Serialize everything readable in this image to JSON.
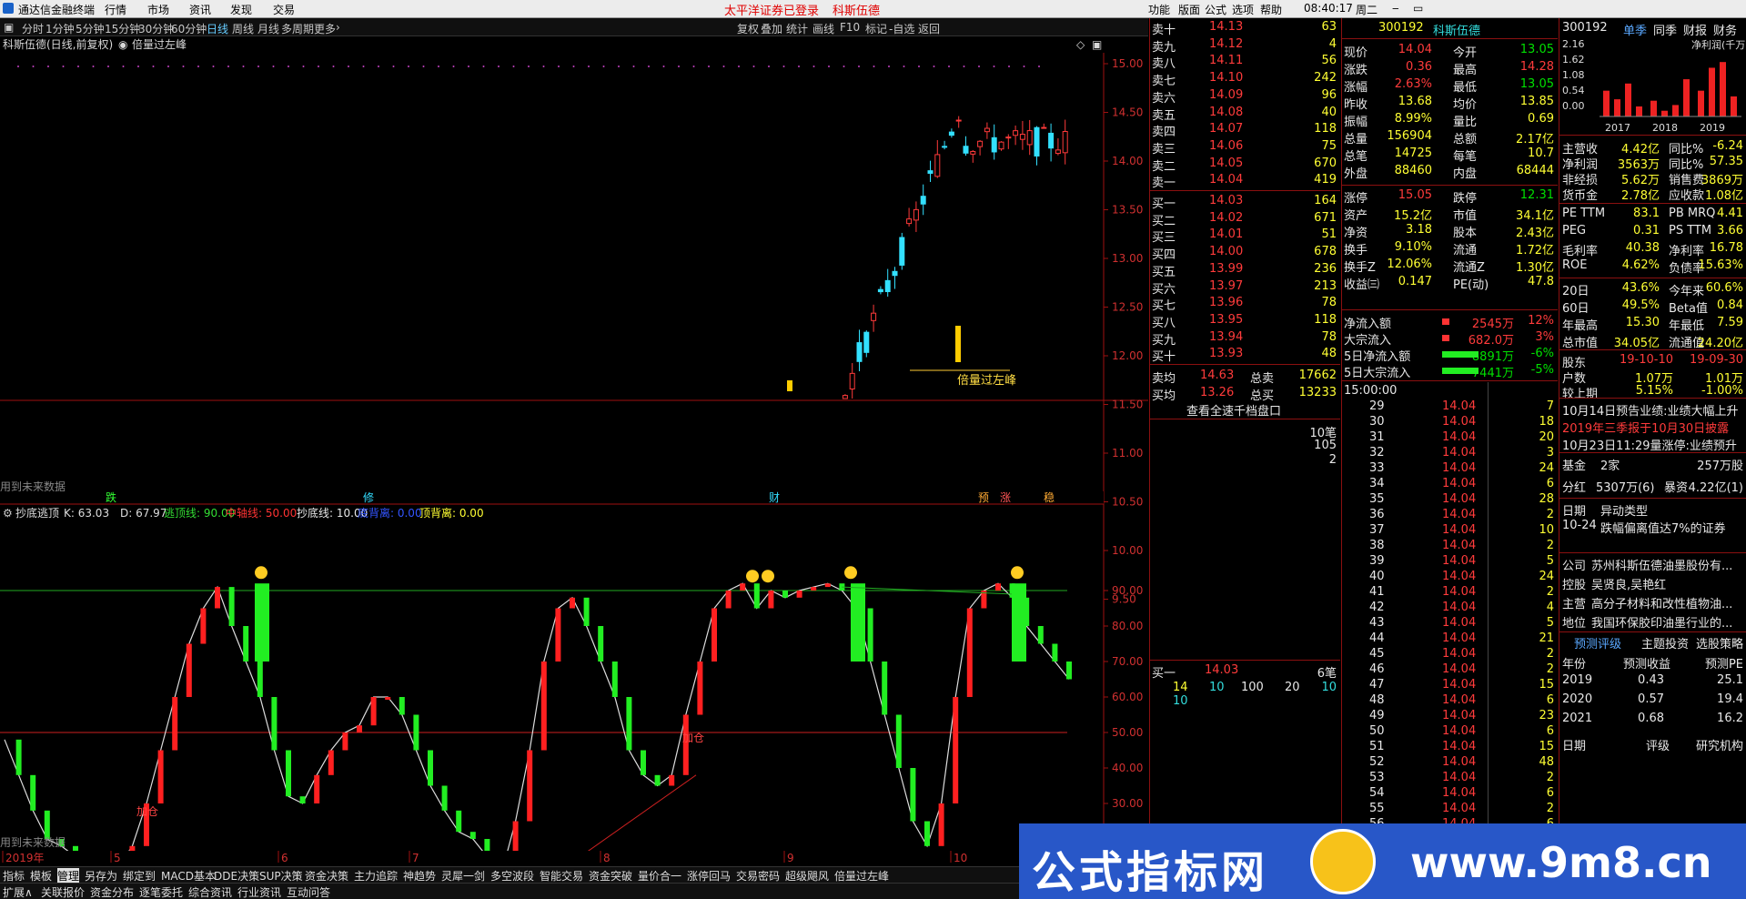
{
  "app": {
    "title": "通达信金融终端",
    "menu": [
      "行情",
      "市场",
      "资讯",
      "发现",
      "交易"
    ],
    "notice": "太平洋证券已登录",
    "stock_name_top": "科斯伍德",
    "right_menu": [
      "功能",
      "版面",
      "公式",
      "选项",
      "帮助"
    ],
    "time": "08:40:17",
    "weekday": "周二"
  },
  "periods": [
    "分时",
    "1分钟",
    "5分钟",
    "15分钟",
    "30分钟",
    "60分钟",
    "日线",
    "周线",
    "月线",
    "多周期",
    "更多"
  ],
  "toolbar": [
    "复权",
    "叠加",
    "统计",
    "画线",
    "F10",
    "标记",
    "-自选",
    "返回"
  ],
  "chart": {
    "header": "科斯伍德(日线,前复权)",
    "indicator_name": "倍量过左峰",
    "price_ticks": [
      "15.00",
      "14.50",
      "14.00",
      "13.50",
      "13.00",
      "12.50",
      "12.00",
      "11.50",
      "11.00",
      "10.50",
      "10.00",
      "9.50"
    ],
    "annotation": "倍量过左峰",
    "future_note": "用到未来数据",
    "markers": [
      "跌",
      "修",
      "财",
      "预",
      "涨",
      "稳"
    ]
  },
  "oscillator": {
    "title": "抄底逃顶",
    "k_label": "K: 63.03",
    "d_label": "D: 67.97",
    "params": [
      {
        "text": "逃顶线: 90.00",
        "color": "#33dd33"
      },
      {
        "text": "中轴线: 50.00",
        "color": "#ff3333"
      },
      {
        "text": "抄底线: 10.00",
        "color": "#e8e8e8"
      },
      {
        "text": "底背离: 0.00",
        "color": "#3355ff"
      },
      {
        "text": "顶背离: 0.00",
        "color": "#ffff33"
      }
    ],
    "ticks": [
      "90.00",
      "80.00",
      "70.00",
      "60.00",
      "50.00",
      "40.00",
      "30.00",
      "20.00",
      "10.00"
    ],
    "labels": [
      "加仓",
      "加仓"
    ],
    "future_note": "用到未来数据"
  },
  "timeline": [
    "2019年",
    "5",
    "6",
    "7",
    "8",
    "9",
    "10"
  ],
  "bottom_tabs_1": [
    "指标",
    "模板",
    "管理",
    "另存为",
    "绑定到",
    "MACD基本",
    "DDE决策",
    "SUP决策",
    "资金决策",
    "主力追踪",
    "神趋势",
    "灵犀一剑",
    "多空波段",
    "智能交易",
    "资金突破",
    "量价合一",
    "涨停回马",
    "交易密码",
    "超级飓风",
    "倍量过左峰"
  ],
  "bottom_tabs_2": [
    "扩展∧",
    "关联报价",
    "资金分布",
    "逐笔委托",
    "综合资讯",
    "行业资讯",
    "互动问答"
  ],
  "orderbook": {
    "asks": [
      [
        "卖十",
        "14.13",
        "63"
      ],
      [
        "卖九",
        "14.12",
        "4"
      ],
      [
        "卖八",
        "14.11",
        "56"
      ],
      [
        "卖七",
        "14.10",
        "242"
      ],
      [
        "卖六",
        "14.09",
        "96"
      ],
      [
        "卖五",
        "14.08",
        "40"
      ],
      [
        "卖四",
        "14.07",
        "118"
      ],
      [
        "卖三",
        "14.06",
        "75"
      ],
      [
        "卖二",
        "14.05",
        "670"
      ],
      [
        "卖一",
        "14.04",
        "419"
      ]
    ],
    "bids": [
      [
        "买一",
        "14.03",
        "164"
      ],
      [
        "买二",
        "14.02",
        "671"
      ],
      [
        "买三",
        "14.01",
        "51"
      ],
      [
        "买四",
        "14.00",
        "678"
      ],
      [
        "买五",
        "13.99",
        "236"
      ],
      [
        "买六",
        "13.97",
        "213"
      ],
      [
        "买七",
        "13.96",
        "78"
      ],
      [
        "买八",
        "13.95",
        "118"
      ],
      [
        "买九",
        "13.94",
        "78"
      ],
      [
        "买十",
        "13.93",
        "48"
      ]
    ],
    "avg": [
      [
        "卖均",
        "14.63",
        "总卖",
        "17662"
      ],
      [
        "买均",
        "13.26",
        "总买",
        "13233"
      ]
    ],
    "more_link": "查看全速千档盘口",
    "tick_count": "10笔",
    "tick_vals": [
      "105",
      "2"
    ],
    "bid1_line": [
      "买一",
      "14.03",
      "6笔"
    ],
    "bid1_queue": [
      "14",
      "10",
      "100",
      "20",
      "10",
      "10"
    ]
  },
  "quote": {
    "code": "300192",
    "name": "科斯伍德",
    "rows": [
      [
        "现价",
        "14.04",
        "今开",
        "13.05"
      ],
      [
        "涨跌",
        "0.36",
        "最高",
        "14.28"
      ],
      [
        "涨幅",
        "2.63%",
        "最低",
        "13.05"
      ],
      [
        "昨收",
        "13.68",
        "均价",
        "13.85"
      ],
      [
        "振幅",
        "8.99%",
        "量比",
        "0.69"
      ],
      [
        "总量",
        "156904",
        "总额",
        "2.17亿"
      ],
      [
        "总笔",
        "14725",
        "每笔",
        "10.7"
      ],
      [
        "外盘",
        "88460",
        "内盘",
        "68444"
      ],
      [
        "涨停",
        "15.05",
        "跌停",
        "12.31"
      ],
      [
        "资产",
        "15.2亿",
        "市值",
        "34.1亿"
      ],
      [
        "净资",
        "3.18",
        "股本",
        "2.43亿"
      ],
      [
        "换手",
        "9.10%",
        "流通",
        "1.72亿"
      ],
      [
        "换手Z",
        "12.06%",
        "流通Z",
        "1.30亿"
      ],
      [
        "收益㈢",
        "0.147",
        "PE(动)",
        "47.8"
      ]
    ],
    "flows": [
      [
        "净流入额",
        "2545万",
        "12%"
      ],
      [
        "大宗流入",
        "682.0万",
        "3%"
      ],
      [
        "5日净流入额",
        "-8891万",
        "-6%"
      ],
      [
        "5日大宗流入",
        "-7441万",
        "-5%"
      ]
    ]
  },
  "ticks": {
    "header": "15:00:00",
    "rows": [
      [
        "29",
        "14.04",
        "7"
      ],
      [
        "30",
        "14.04",
        "18"
      ],
      [
        "31",
        "14.04",
        "20"
      ],
      [
        "32",
        "14.04",
        "3"
      ],
      [
        "33",
        "14.04",
        "24"
      ],
      [
        "34",
        "14.04",
        "6"
      ],
      [
        "35",
        "14.04",
        "28"
      ],
      [
        "36",
        "14.04",
        "2"
      ],
      [
        "37",
        "14.04",
        "10"
      ],
      [
        "38",
        "14.04",
        "2"
      ],
      [
        "39",
        "14.04",
        "5"
      ],
      [
        "40",
        "14.04",
        "24"
      ],
      [
        "41",
        "14.04",
        "2"
      ],
      [
        "42",
        "14.04",
        "4"
      ],
      [
        "43",
        "14.04",
        "5"
      ],
      [
        "44",
        "14.04",
        "21"
      ],
      [
        "45",
        "14.04",
        "2"
      ],
      [
        "46",
        "14.04",
        "2"
      ],
      [
        "47",
        "14.04",
        "15"
      ],
      [
        "48",
        "14.04",
        "6"
      ],
      [
        "49",
        "14.04",
        "23"
      ],
      [
        "50",
        "14.04",
        "6"
      ],
      [
        "51",
        "14.04",
        "15"
      ],
      [
        "52",
        "14.04",
        "48"
      ],
      [
        "53",
        "14.04",
        "2"
      ],
      [
        "54",
        "14.04",
        "6"
      ],
      [
        "55",
        "14.04",
        "2"
      ],
      [
        "56",
        "14.04",
        "6"
      ],
      [
        "57",
        "14.04",
        "1"
      ]
    ]
  },
  "f10": {
    "code": "300192",
    "tabs": [
      "单季",
      "同季",
      "财报",
      "财务"
    ],
    "unit": "净利润(千万)",
    "chart_data": {
      "type": "bar",
      "categories": [
        "2017",
        "2018",
        "2019"
      ],
      "y_ticks": [
        "2.16",
        "1.62",
        "1.08",
        "0.54",
        "0.00"
      ],
      "values": [
        0.9,
        0.6,
        1.15,
        0.35,
        0.55,
        0.2,
        0.4,
        1.3,
        0.9,
        1.7,
        1.9,
        0.7
      ],
      "ylim": [
        0,
        2.16
      ]
    },
    "fin": [
      [
        "主营收",
        "4.42亿",
        "同比%",
        "-6.24"
      ],
      [
        "净利润",
        "3563万",
        "同比%",
        "57.35"
      ],
      [
        "非经损",
        "5.62万",
        "销售费",
        "3869万"
      ],
      [
        "货币金",
        "2.78亿",
        "应收款",
        "1.08亿"
      ]
    ],
    "ratios": [
      [
        "PE TTM",
        "83.1",
        "PB MRQ",
        "4.41"
      ],
      [
        "PEG",
        "0.31",
        "PS TTM",
        "3.66"
      ],
      [
        "毛利率",
        "40.38",
        "净利率",
        "16.78"
      ],
      [
        "ROE",
        "4.62%",
        "负债率",
        "15.63%"
      ]
    ],
    "perf": [
      [
        "20日",
        "43.6%",
        "今年来",
        "60.6%"
      ],
      [
        "60日",
        "49.5%",
        "Beta值",
        "0.84"
      ],
      [
        "年最高",
        "15.30",
        "年最低",
        "7.59"
      ],
      [
        "总市值",
        "34.05亿",
        "流通值",
        "24.20亿"
      ]
    ],
    "holders": [
      [
        "股东",
        "19-10-10",
        "19-09-30"
      ],
      [
        "户数",
        "1.07万",
        "1.01万"
      ],
      [
        "较上期",
        "5.15%",
        "-1.00%"
      ]
    ],
    "news": [
      "10月14日预告业绩:业绩大幅上升",
      "2019年三季报于10月30日披露",
      "10月23日11:29量涨停:业绩预升"
    ],
    "fund": [
      [
        "基金",
        "2家",
        "257万股"
      ],
      [
        "分红",
        "5307万(6)",
        "暴资",
        "4.22亿(1)"
      ]
    ],
    "anomaly": [
      [
        "日期",
        "异动类型"
      ],
      [
        "10-24",
        "跌幅偏离值达7%的证券"
      ]
    ],
    "company": [
      [
        "公司",
        "苏州科斯伍德油墨股份有..."
      ],
      [
        "控股",
        "吴贤良,吴艳红"
      ],
      [
        "主营",
        "高分子材料和改性植物油..."
      ],
      [
        "地位",
        "我国环保胶印油墨行业的..."
      ]
    ],
    "forecast_tabs": [
      "预测评级",
      "主题投资",
      "选股策略"
    ],
    "forecast_head": [
      "年份",
      "预测收益",
      "预测PE"
    ],
    "forecast": [
      [
        "2019",
        "0.43",
        "25.1"
      ],
      [
        "2020",
        "0.57",
        "19.4"
      ],
      [
        "2021",
        "0.68",
        "16.2"
      ]
    ],
    "rating_head": [
      "日期",
      "评级",
      "研究机构"
    ]
  },
  "watermark": {
    "text": "公式指标网",
    "url": "www.9m8.cn"
  }
}
